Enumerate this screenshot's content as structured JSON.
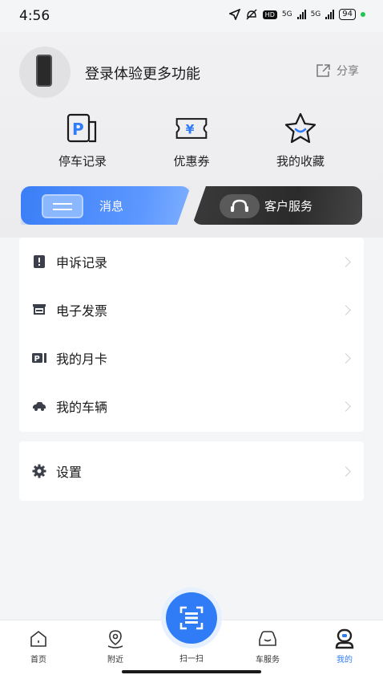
{
  "status": {
    "time": "4:56",
    "battery": "94",
    "net1": "5G",
    "net2": "5G",
    "hd": "HD"
  },
  "profile": {
    "login_prompt": "登录体验更多功能",
    "share_label": "分享"
  },
  "quick_actions": [
    {
      "label": "停车记录",
      "icon": "parking-record-icon"
    },
    {
      "label": "优惠券",
      "icon": "coupon-icon"
    },
    {
      "label": "我的收藏",
      "icon": "star-icon"
    }
  ],
  "tabs": {
    "messages": "消息",
    "customer_service": "客户服务"
  },
  "menu": [
    {
      "label": "申诉记录",
      "icon": "complaint-icon"
    },
    {
      "label": "电子发票",
      "icon": "invoice-icon"
    },
    {
      "label": "我的月卡",
      "icon": "monthly-card-icon"
    },
    {
      "label": "我的车辆",
      "icon": "car-icon"
    }
  ],
  "settings": {
    "label": "设置",
    "icon": "gear-icon"
  },
  "tabbar": {
    "home": "首页",
    "nearby": "附近",
    "scan": "扫一扫",
    "car_service": "车服务",
    "mine": "我的"
  },
  "colors": {
    "accent": "#2f7cf6",
    "dark_tab": "#2b2b2b"
  }
}
